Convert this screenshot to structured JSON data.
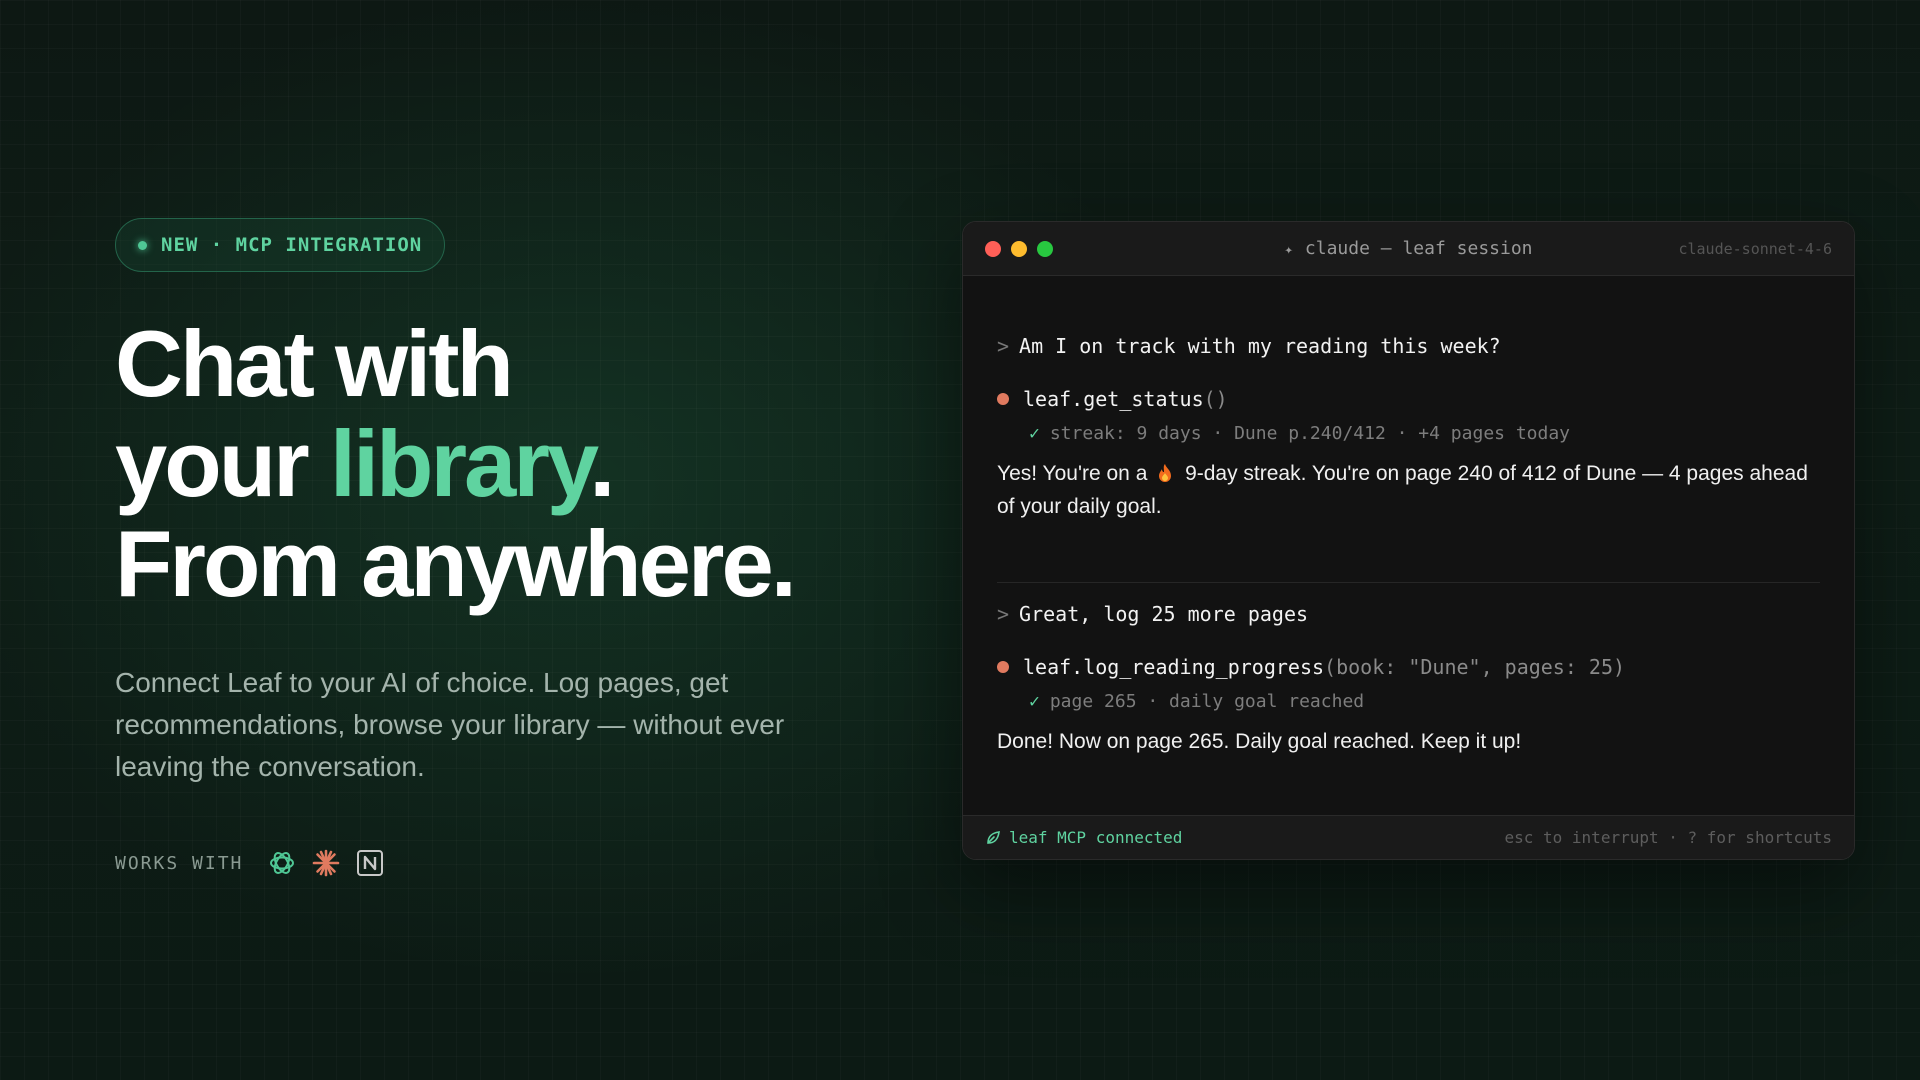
{
  "badge": {
    "text": "NEW · MCP INTEGRATION"
  },
  "hero": {
    "line1": "Chat with",
    "line2_prefix": "your ",
    "line2_accent": "library",
    "line2_suffix": ".",
    "line3": "From anywhere."
  },
  "subtitle": "Connect Leaf to your AI of choice. Log pages, get recommendations, browse your library — without ever leaving the conversation.",
  "works_with": {
    "label": "WORKS WITH",
    "logos": [
      "openai-icon",
      "claude-icon",
      "notion-icon"
    ]
  },
  "terminal": {
    "title": "claude — leaf session",
    "model": "claude-sonnet-4-6",
    "messages": [
      {
        "prompt": "Am I on track with my reading this week?",
        "tool_name": "leaf.get_status",
        "tool_args": "()",
        "result": "streak: 9 days · Dune p.240/412 · +4 pages today",
        "reply_pre": "Yes! You're on a",
        "reply_post": "9-day streak. You're on page 240 of 412 of Dune — 4 pages ahead of your daily goal."
      },
      {
        "prompt": "Great, log 25 more pages",
        "tool_name": "leaf.log_reading_progress",
        "tool_args": "(book: \"Dune\", pages: 25)",
        "result": "page 265 · daily goal reached",
        "reply": "Done! Now on page 265. Daily goal reached. Keep it up!"
      }
    ],
    "status_left": "leaf MCP connected",
    "status_right": "esc to interrupt · ? for shortcuts"
  },
  "colors": {
    "accent": "#5fd3a0",
    "tool_dot": "#e07a5f",
    "traffic_red": "#ff5f57",
    "traffic_yellow": "#febc2e",
    "traffic_green": "#28c840"
  }
}
